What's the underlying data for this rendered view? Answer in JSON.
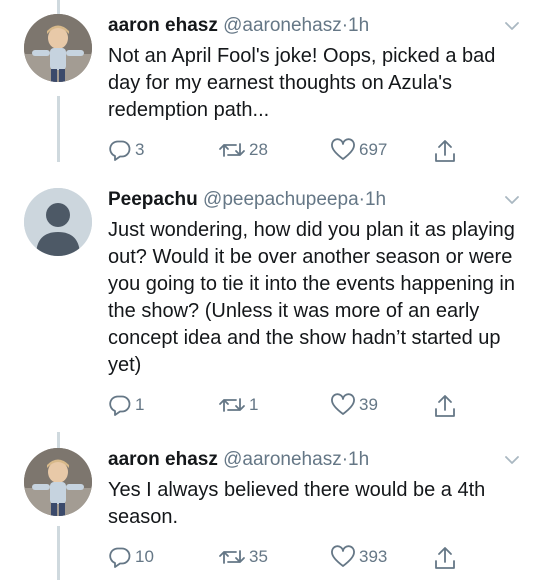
{
  "tweets": [
    {
      "name": "aaron ehasz",
      "handle": "@aaronehasz",
      "separator": "·",
      "time": "1h",
      "text": "Not an April Fool's joke! Oops, picked a bad day for my earnest thoughts on Azula's redemption path...",
      "replies": "3",
      "retweets": "28",
      "likes": "697"
    },
    {
      "name": "Peepachu",
      "handle": "@peepachupeepa",
      "separator": "·",
      "time": "1h",
      "text": "Just wondering, how did you plan it as playing out? Would it be over another season or were you going to tie it into the events happening in the show? (Unless it was more of an early concept idea and the show hadn’t started up yet)",
      "replies": "1",
      "retweets": "1",
      "likes": "39"
    },
    {
      "name": "aaron ehasz",
      "handle": "@aaronehasz",
      "separator": "·",
      "time": "1h",
      "text": "Yes I always believed there would be a 4th season.",
      "replies": "10",
      "retweets": "35",
      "likes": "393"
    }
  ]
}
